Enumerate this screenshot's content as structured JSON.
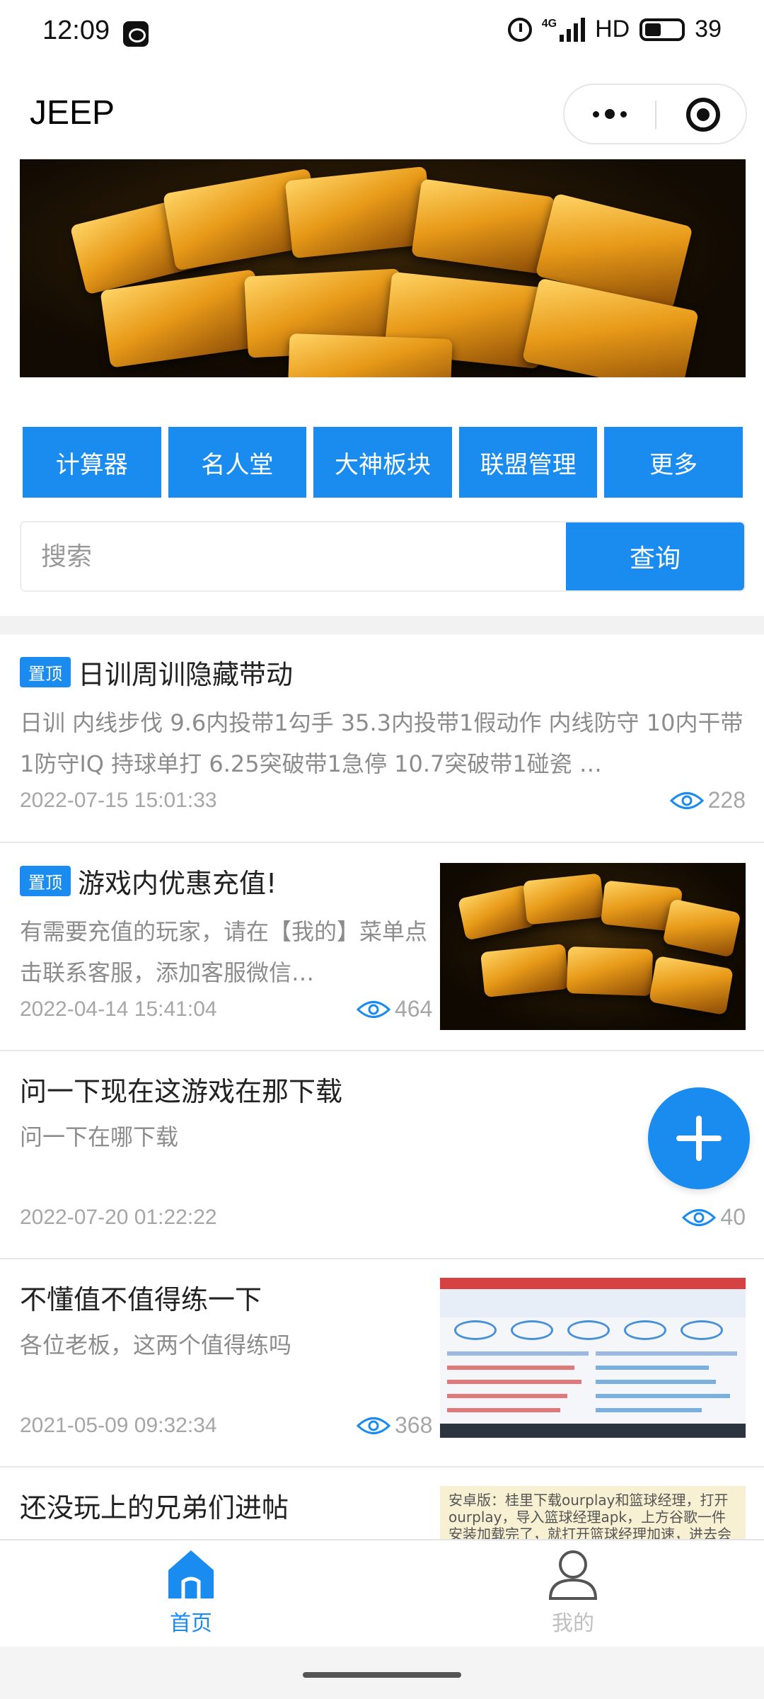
{
  "status_bar": {
    "time": "12:09",
    "network": "HD",
    "battery": "39",
    "signal_label": "4G"
  },
  "header": {
    "title": "JEEP",
    "more_icon": "more-dots-icon",
    "close_icon": "target-close-icon"
  },
  "banner": {
    "image": "gold-bars-image"
  },
  "categories": [
    {
      "label": "计算器"
    },
    {
      "label": "名人堂"
    },
    {
      "label": "大神板块"
    },
    {
      "label": "联盟管理"
    },
    {
      "label": "更多"
    }
  ],
  "search": {
    "placeholder": "搜索",
    "button_label": "查询"
  },
  "posts": [
    {
      "pinned_badge": "置顶",
      "title": "日训周训隐藏带动",
      "excerpt": "日训 内线步伐 9.6内投带1勾手 35.3内投带1假动作 内线防守 10内干带1防守IQ 持球单打 6.25突破带1急停 10.7突破带1碰瓷 …",
      "date": "2022-07-15 15:01:33",
      "views": "228"
    },
    {
      "pinned_badge": "置顶",
      "title": "游戏内优惠充值!",
      "excerpt": "有需要充值的玩家，请在【我的】菜单点击联系客服，添加客服微信…",
      "date": "2022-04-14 15:41:04",
      "views": "464"
    },
    {
      "title": "问一下现在这游戏在那下载",
      "excerpt": "问一下在哪下载",
      "date": "2022-07-20 01:22:22",
      "views": "40"
    },
    {
      "title": "不懂值不值得练一下",
      "excerpt": "各位老板，这两个值得练吗",
      "date": "2021-05-09 09:32:34",
      "views": "368"
    },
    {
      "title": "还没玩上的兄弟们进帖",
      "thumb_text": "安卓版：桂里下载ourplay和篮球经理，打开ourplay，导入篮球经理apk，上方谷歌一件安装加载完了，就打开篮球经理加速，进去会弹窗让你登陆"
    }
  ],
  "fab": {
    "icon": "plus-icon"
  },
  "tab_bar": {
    "home_label": "首页",
    "profile_label": "我的",
    "active_color": "#1a8cf0",
    "inactive_color": "#bfbfbf"
  },
  "colors": {
    "primary": "#1a8cf0"
  }
}
